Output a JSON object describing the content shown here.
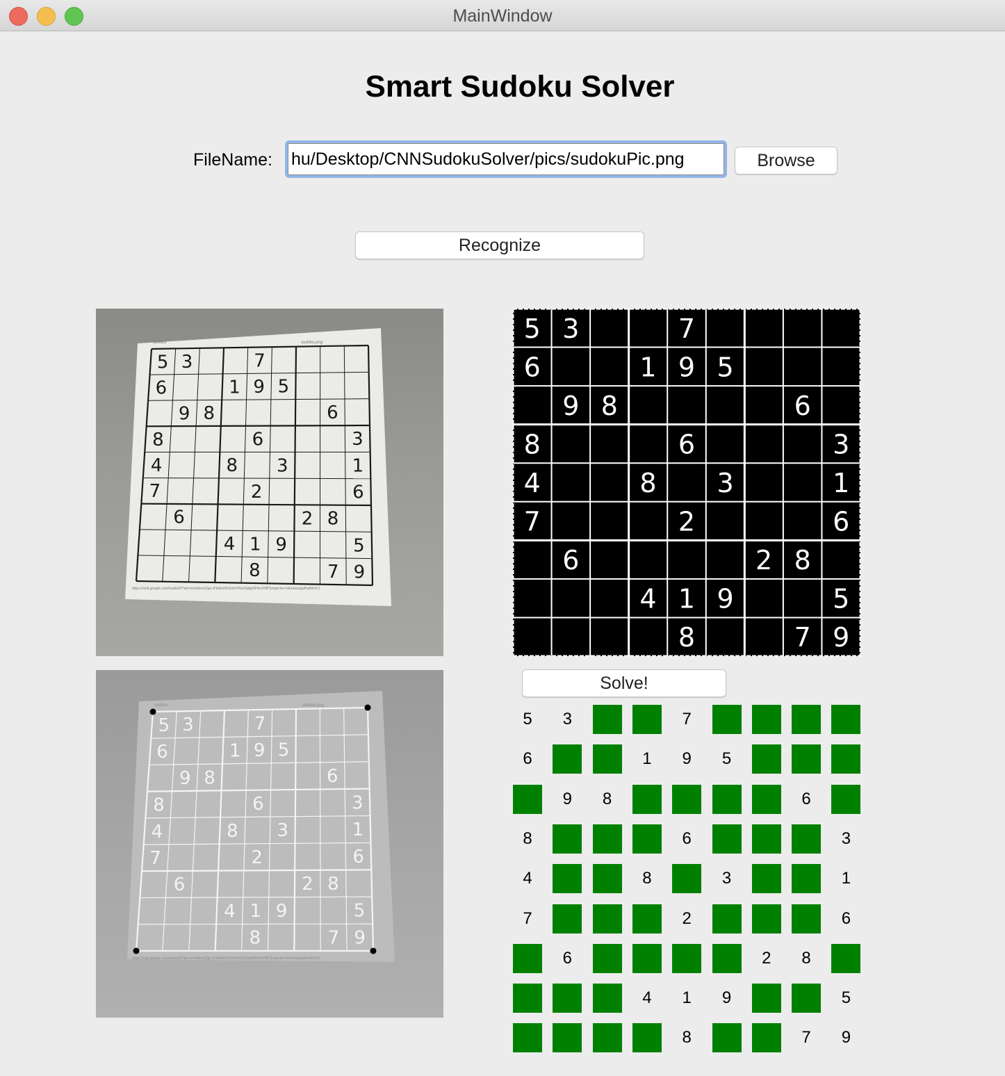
{
  "window": {
    "title": "MainWindow",
    "colors": {
      "close": "#ed6a5e",
      "minimize": "#f4bf4f",
      "zoom": "#61c554"
    }
  },
  "app": {
    "title": "Smart Sudoku Solver",
    "file_label": "FileName:",
    "file_value": "hu/Desktop/CNNSudokuSolver/pics/sudokuPic.png",
    "browse_label": "Browse",
    "recognize_label": "Recognize",
    "solve_label": "Solve!"
  },
  "images": {
    "original_photo": "photo-of-printed-sudoku",
    "detected_corners_photo": "grayscale-photo-with-corner-markers",
    "warped_binary_grid": "thresholded-warped-sudoku"
  },
  "photo_caption": {
    "left": "sudoku",
    "right": "sudoku.png",
    "bottom": "https://mail.google.com/mail/u/0/?ab=rm#inbox/QgrcJHsBmFfcSmXVKdcFjdjqiSFNvVHB?projector=1&messagePartId=0.1"
  },
  "puzzle": [
    [
      5,
      3,
      0,
      0,
      7,
      0,
      0,
      0,
      0
    ],
    [
      6,
      0,
      0,
      1,
      9,
      5,
      0,
      0,
      0
    ],
    [
      0,
      9,
      8,
      0,
      0,
      0,
      0,
      6,
      0
    ],
    [
      8,
      0,
      0,
      0,
      6,
      0,
      0,
      0,
      3
    ],
    [
      4,
      0,
      0,
      8,
      0,
      3,
      0,
      0,
      1
    ],
    [
      7,
      0,
      0,
      0,
      2,
      0,
      0,
      0,
      6
    ],
    [
      0,
      6,
      0,
      0,
      0,
      0,
      2,
      8,
      0
    ],
    [
      0,
      0,
      0,
      4,
      1,
      9,
      0,
      0,
      5
    ],
    [
      0,
      0,
      0,
      0,
      8,
      0,
      0,
      7,
      9
    ]
  ],
  "colors": {
    "empty_cell": "#008000",
    "focus_ring": "#93b5e9"
  }
}
